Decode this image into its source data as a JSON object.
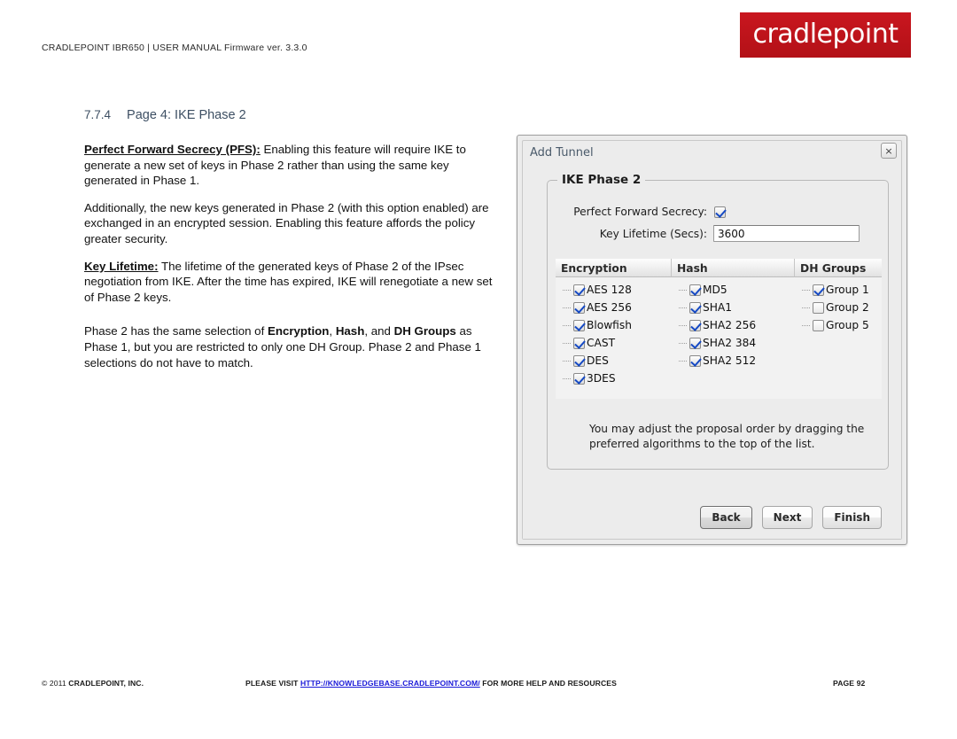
{
  "header": {
    "breadcrumb": "CRADLEPOINT IBR650 | USER MANUAL Firmware ver. 3.3.0",
    "logo_text": "cradlepoint",
    "logo_color": "#c1121c"
  },
  "section": {
    "number": "7.7.4",
    "title": "Page 4: IKE Phase 2",
    "color": "#3d4f63"
  },
  "body": {
    "p1_lead": "Perfect Forward Secrecy (PFS):",
    "p1_text": " Enabling this feature will require IKE to generate a new set of keys in Phase 2 rather than using the same key generated in Phase 1.",
    "p2_text": "Additionally, the new keys generated in Phase 2 (with this option enabled) are exchanged in an encrypted session. Enabling this feature affords the policy greater security.",
    "p3_lead": "Key Lifetime:",
    "p3_text": " The lifetime of the generated keys of Phase 2 of the IPsec negotiation from IKE. After the time has expired, IKE will renegotiate a new set of Phase 2 keys.",
    "p4_a": "Phase 2 has the same selection of ",
    "p4_b1": "Encryption",
    "p4_c": ", ",
    "p4_b2": "Hash",
    "p4_d": ", and ",
    "p4_b3": "DH Groups",
    "p4_e": " as Phase 1, but you are restricted to only one DH Group. Phase 2 and Phase 1 selections do not have to match."
  },
  "dialog": {
    "title": "Add Tunnel",
    "close_icon": "×",
    "fieldset_legend": "IKE Phase 2",
    "pfs_label": "Perfect Forward Secrecy:",
    "pfs_checked": true,
    "key_lifetime_label": "Key Lifetime (Secs):",
    "key_lifetime_value": "3600",
    "key_lifetime_placeholder": "3600",
    "table": {
      "headers": [
        "Encryption",
        "Hash",
        "DH Groups"
      ],
      "encryption": [
        {
          "label": "AES 128",
          "checked": true
        },
        {
          "label": "AES 256",
          "checked": true
        },
        {
          "label": "Blowfish",
          "checked": true
        },
        {
          "label": "CAST",
          "checked": true
        },
        {
          "label": "DES",
          "checked": true
        },
        {
          "label": "3DES",
          "checked": true
        }
      ],
      "hash": [
        {
          "label": "MD5",
          "checked": true
        },
        {
          "label": "SHA1",
          "checked": true
        },
        {
          "label": "SHA2 256",
          "checked": true
        },
        {
          "label": "SHA2 384",
          "checked": true
        },
        {
          "label": "SHA2 512",
          "checked": true
        }
      ],
      "dh_groups": [
        {
          "label": "Group 1",
          "checked": true
        },
        {
          "label": "Group 2",
          "checked": false
        },
        {
          "label": "Group 5",
          "checked": false
        }
      ]
    },
    "note": "You may adjust the proposal order by dragging the preferred algorithms to the top of the list.",
    "buttons": [
      {
        "label": "Back",
        "focused": true
      },
      {
        "label": "Next",
        "focused": false
      },
      {
        "label": "Finish",
        "focused": false
      }
    ]
  },
  "footer": {
    "copyright_year": "© 2011 ",
    "copyright_name": "CRADLEPOINT, INC.",
    "visit_prefix": "PLEASE VISIT ",
    "visit_link": "HTTP://KNOWLEDGEBASE.CRADLEPOINT.COM/",
    "visit_suffix": " FOR MORE HELP AND RESOURCES",
    "page_label": "PAGE 92",
    "link_color": "#1a19d8"
  }
}
